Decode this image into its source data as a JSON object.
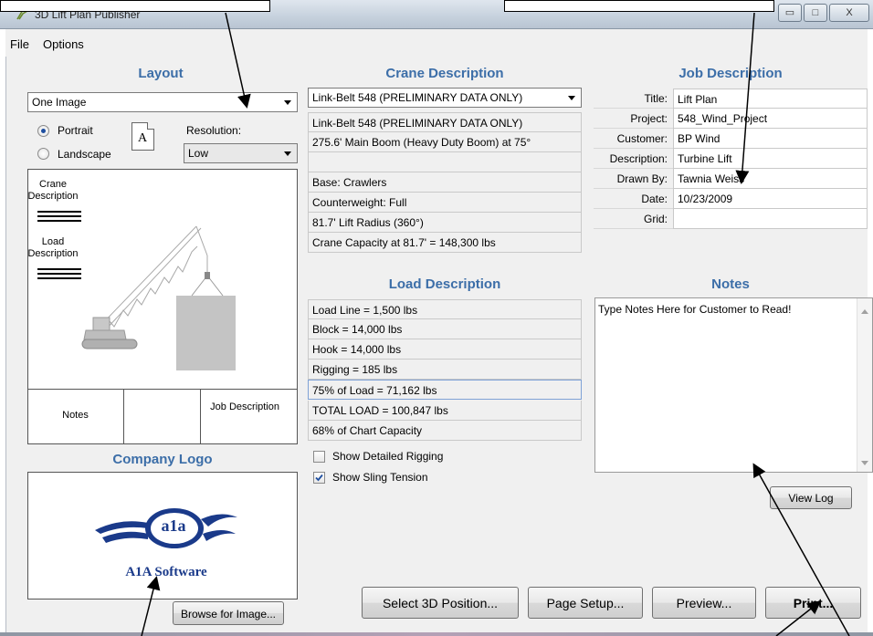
{
  "window": {
    "title": "3D Lift Plan Publisher",
    "minimize_glyph": "▭",
    "maximize_glyph": "□",
    "close_glyph": "X"
  },
  "menu": [
    "File",
    "Options"
  ],
  "layout": {
    "heading": "Layout",
    "layout_select": "One Image",
    "orientation": [
      {
        "label": "Portrait",
        "selected": true
      },
      {
        "label": "Landscape",
        "selected": false
      }
    ],
    "page_icon_letter": "A",
    "resolution_label": "Resolution:",
    "resolution_select": "Low",
    "preview": {
      "crane_label": "Crane Description",
      "load_label": "Load Description",
      "notes_label": "Notes",
      "job_label": "Job Description"
    }
  },
  "company_logo": {
    "heading": "Company Logo",
    "logo_text": "A1A Software",
    "logo_mark": "a1a",
    "browse_button": "Browse for Image..."
  },
  "crane": {
    "heading": "Crane Description",
    "crane_select": "Link-Belt 548 (PRELIMINARY DATA ONLY)",
    "lines": [
      "Link-Belt 548 (PRELIMINARY DATA ONLY)",
      "275.6' Main Boom (Heavy Duty Boom) at 75°",
      "",
      "Base: Crawlers",
      "Counterweight: Full",
      "81.7' Lift Radius (360°)",
      "Crane Capacity at 81.7' = 148,300 lbs"
    ]
  },
  "load": {
    "heading": "Load Description",
    "lines": [
      "Load Line = 1,500 lbs",
      "Block = 14,000 lbs",
      "Hook = 14,000 lbs",
      "Rigging = 185 lbs",
      "75% of Load = 71,162 lbs",
      "TOTAL LOAD = 100,847 lbs",
      "68% of Chart Capacity"
    ],
    "checkboxes": [
      {
        "label": "Show Detailed Rigging",
        "checked": false
      },
      {
        "label": "Show Sling Tension",
        "checked": true
      }
    ]
  },
  "job": {
    "heading": "Job Description",
    "rows": [
      {
        "label": "Title:",
        "value": "Lift Plan"
      },
      {
        "label": "Project:",
        "value": "548_Wind_Project"
      },
      {
        "label": "Customer:",
        "value": "BP Wind"
      },
      {
        "label": "Description:",
        "value": "Turbine Lift"
      },
      {
        "label": "Drawn By:",
        "value": "Tawnia Weiss"
      },
      {
        "label": "Date:",
        "value": "10/23/2009"
      },
      {
        "label": "Grid:",
        "value": ""
      }
    ]
  },
  "notes": {
    "heading": "Notes",
    "text": "Type Notes Here for Customer to Read!",
    "view_log_button": "View Log"
  },
  "actions": {
    "select_3d": "Select 3D Position...",
    "page_setup": "Page Setup...",
    "preview": "Preview...",
    "print": "Print..."
  },
  "colors": {
    "heading": "#3c6ea8",
    "logo_blue": "#1a3a8a"
  }
}
